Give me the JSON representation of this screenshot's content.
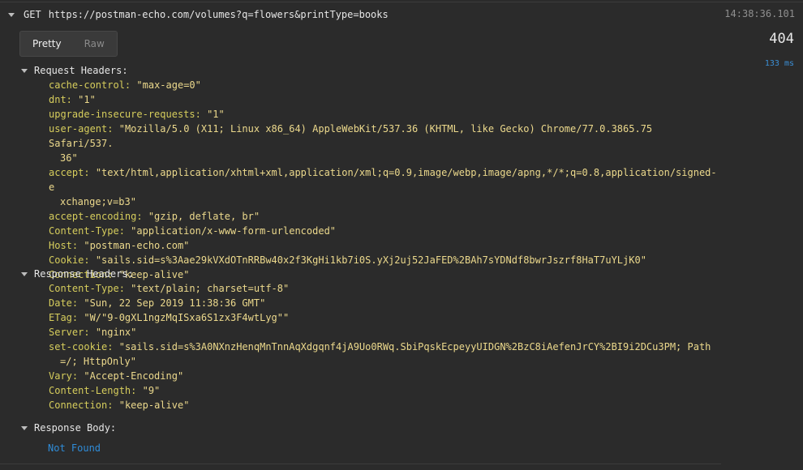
{
  "request": {
    "method": "GET",
    "url": "https://postman-echo.com/volumes?q=flowers&printType=books",
    "timestamp": "14:38:36.101",
    "status": "404",
    "duration": "133 ms"
  },
  "tabs": {
    "pretty": "Pretty",
    "raw": "Raw"
  },
  "request_headers": {
    "title": "Request Headers:",
    "rows": [
      {
        "key": "cache-control:",
        "value": "\"max-age=0\""
      },
      {
        "key": "dnt:",
        "value": "\"1\""
      },
      {
        "key": "upgrade-insecure-requests:",
        "value": "\"1\""
      },
      {
        "key": "user-agent:",
        "value": "\"Mozilla/5.0 (X11; Linux x86_64) AppleWebKit/537.36 (KHTML, like Gecko) Chrome/77.0.3865.75 Safari/537.",
        "cont": "36\""
      },
      {
        "key": "accept:",
        "value": "\"text/html,application/xhtml+xml,application/xml;q=0.9,image/webp,image/apng,*/*;q=0.8,application/signed-e",
        "cont": "xchange;v=b3\""
      },
      {
        "key": "accept-encoding:",
        "value": "\"gzip, deflate, br\""
      },
      {
        "key": "Content-Type:",
        "value": "\"application/x-www-form-urlencoded\""
      },
      {
        "key": "Host:",
        "value": "\"postman-echo.com\""
      },
      {
        "key": "Cookie:",
        "value": "\"sails.sid=s%3Aae29kVXdOTnRRBw40x2f3KgHi1kb7i0S.yXj2uj52JaFED%2BAh7sYDNdf8bwrJszrf8HaT7uYLjK0\""
      },
      {
        "key": "Connection:",
        "value": "\"keep-alive\""
      }
    ]
  },
  "response_headers": {
    "title": "Response Headers:",
    "rows": [
      {
        "key": "Content-Type:",
        "value": "\"text/plain; charset=utf-8\""
      },
      {
        "key": "Date:",
        "value": "\"Sun, 22 Sep 2019 11:38:36 GMT\""
      },
      {
        "key": "ETag:",
        "value": "\"W/\"9-0gXL1ngzMqISxa6S1zx3F4wtLyg\"\""
      },
      {
        "key": "Server:",
        "value": "\"nginx\""
      },
      {
        "key": "set-cookie:",
        "value": "\"sails.sid=s%3A0NXnzHenqMnTnnAqXdgqnf4jA9Uo0RWq.SbiPqskEcpeyyUIDGN%2BzC8iAefenJrCY%2BI9i2DCu3PM; Path",
        "cont": "=/; HttpOnly\""
      },
      {
        "key": "Vary:",
        "value": "\"Accept-Encoding\""
      },
      {
        "key": "Content-Length:",
        "value": "\"9\""
      },
      {
        "key": "Connection:",
        "value": "\"keep-alive\""
      }
    ]
  },
  "response_body": {
    "title": "Response Body:",
    "text": "Not Found"
  }
}
